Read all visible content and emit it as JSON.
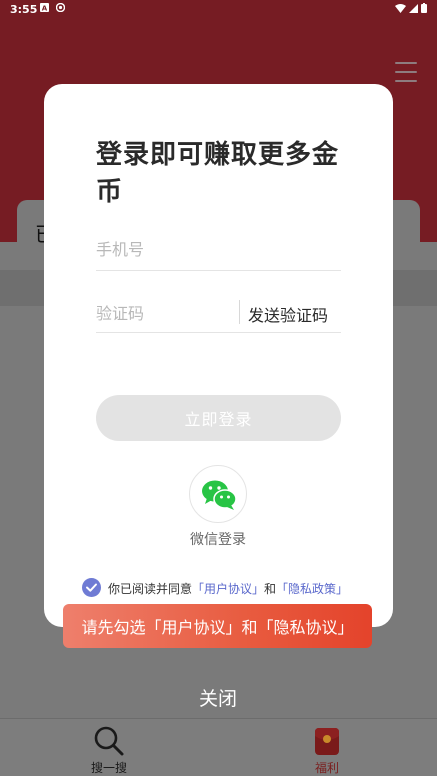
{
  "status_bar": {
    "time": "3:55",
    "left_icons": [
      "a-notification-icon",
      "circle-notification-icon"
    ],
    "right_icons": [
      "wifi-icon",
      "signal-icon",
      "battery-icon"
    ]
  },
  "background": {
    "card_text": "已",
    "menu_icon": "hamburger-icon"
  },
  "tab_bar": {
    "tabs": [
      {
        "label": "搜一搜",
        "icon": "magnifier-icon"
      },
      {
        "label": "福利",
        "icon": "red-envelope-icon"
      }
    ]
  },
  "login_dialog": {
    "title": "登录即可赚取更多金币",
    "phone_placeholder": "手机号",
    "phone_value": "",
    "code_placeholder": "验证码",
    "code_value": "",
    "send_code_label": "发送验证码",
    "login_button_label": "立即登录",
    "wechat_label": "微信登录",
    "agreement": {
      "prefix": "你已阅读并同意",
      "user_agreement": "「用户协议」",
      "conjunction": "和",
      "privacy_policy": "「隐私政策」",
      "checked": true
    }
  },
  "toast": {
    "text": "请先勾选「用户协议」和「隐私协议」"
  },
  "close_label": "关闭",
  "colors": {
    "brand_red": "#761c23",
    "link_blue": "#5a68cc",
    "wechat_green": "#28c445",
    "toast_red": "#e4432b"
  }
}
